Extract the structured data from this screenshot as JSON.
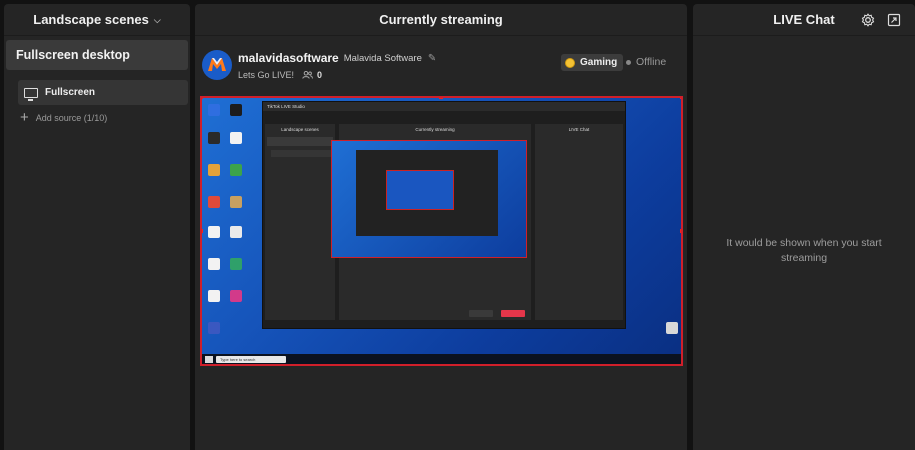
{
  "left_panel": {
    "title": "Landscape scenes",
    "scene_name": "Fullscreen desktop",
    "sources": [
      {
        "label": "Fullscreen",
        "icon": "monitor-icon"
      }
    ],
    "add_source_label": "Add source (1/10)"
  },
  "center_panel": {
    "title": "Currently streaming",
    "profile": {
      "name": "malavidasoftware",
      "handle": "Malavida Software",
      "tagline": "Lets Go LIVE!",
      "viewer_count": "0"
    },
    "category": "Gaming",
    "status": "Offline",
    "preview": {
      "nested_window_title": "TikTok LIVE Studio",
      "nested_left_title": "Landscape scenes",
      "nested_center_title": "Currently streaming",
      "nested_right_title": "LIVE Chat",
      "taskbar_search": "Type here to search"
    }
  },
  "right_panel": {
    "title": "LIVE Chat",
    "empty_message": "It would be shown when you start streaming"
  },
  "colors": {
    "background": "#121212",
    "panel": "#252525",
    "accent_red": "#d01f2a",
    "gaming_badge": "#f4c234"
  }
}
